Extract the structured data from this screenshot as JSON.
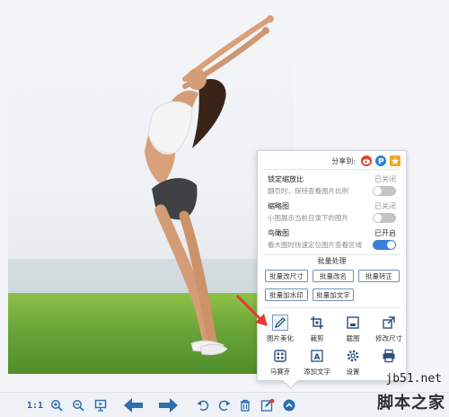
{
  "share": {
    "label": "分享到:",
    "icons": [
      "weibo-icon",
      "qzone-icon",
      "favorite-star-icon"
    ]
  },
  "settings": [
    {
      "title": "锁定缩放比",
      "status": "已关闭",
      "desc": "翻页时，保持查看图片比例",
      "on": false
    },
    {
      "title": "缩略图",
      "status": "已关闭",
      "desc": "小图展示当前目录下的图片",
      "on": false
    },
    {
      "title": "鸟瞰图",
      "status": "已开启",
      "desc": "看大图时快速定位图片查看区域",
      "on": true
    }
  ],
  "batch": {
    "title": "批量处理",
    "buttons": [
      "批量改尺寸",
      "批量改名",
      "批量转正",
      "批量加水印",
      "批量加文字"
    ]
  },
  "tools": [
    {
      "label": "图片美化",
      "icon": "pencil-icon"
    },
    {
      "label": "裁剪",
      "icon": "crop-icon"
    },
    {
      "label": "截图",
      "icon": "screenshot-icon"
    },
    {
      "label": "修改尺寸",
      "icon": "resize-icon"
    },
    {
      "label": "马赛克",
      "icon": "mosaic-icon"
    },
    {
      "label": "添加文字",
      "icon": "add-text-icon"
    },
    {
      "label": "设置",
      "icon": "gear-icon"
    },
    {
      "label": "",
      "icon": "printer-icon"
    }
  ],
  "toolbar": {
    "ratio_label": "1:1",
    "buttons": [
      "zoom-in-icon",
      "zoom-out-icon",
      "slideshow-icon",
      "previous-arrow-icon",
      "next-arrow-icon",
      "rotate-left-icon",
      "rotate-right-icon",
      "delete-icon",
      "edit-icon",
      "more-up-icon"
    ]
  },
  "watermark": {
    "url": "jb51.net",
    "name": "脚本之家"
  },
  "colors": {
    "accent": "#3b7fd9",
    "toolbar_icon": "#2d6db0",
    "grass": "#6aa636",
    "arrow": "#e53935"
  }
}
